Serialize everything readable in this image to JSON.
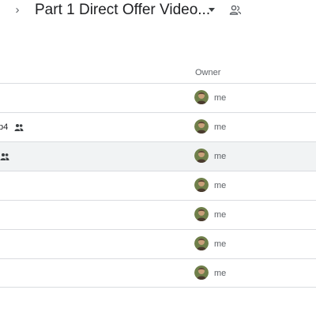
{
  "breadcrumb": {
    "chevron_icon": "chevron-right-icon",
    "title": "Part 1 Direct Offer Video...",
    "caret_icon": "caret-down-icon",
    "shared_icon": "shared-folder-icon"
  },
  "table": {
    "owner_header": "Owner",
    "rows": [
      {
        "name": "",
        "owner": "me",
        "shared": false,
        "selected": false
      },
      {
        "name": "p4",
        "owner": "me",
        "shared": true,
        "selected": false
      },
      {
        "name": "",
        "owner": "me",
        "shared": true,
        "selected": true
      },
      {
        "name": "",
        "owner": "me",
        "shared": false,
        "selected": false
      },
      {
        "name": "",
        "owner": "me",
        "shared": false,
        "selected": false
      },
      {
        "name": "",
        "owner": "me",
        "shared": false,
        "selected": false
      },
      {
        "name": "",
        "owner": "me",
        "shared": false,
        "selected": false
      }
    ]
  },
  "colors": {
    "border": "#dadce0",
    "selected_row": "#f1f3f4",
    "text_primary": "#202124",
    "text_secondary": "#5f6368"
  }
}
